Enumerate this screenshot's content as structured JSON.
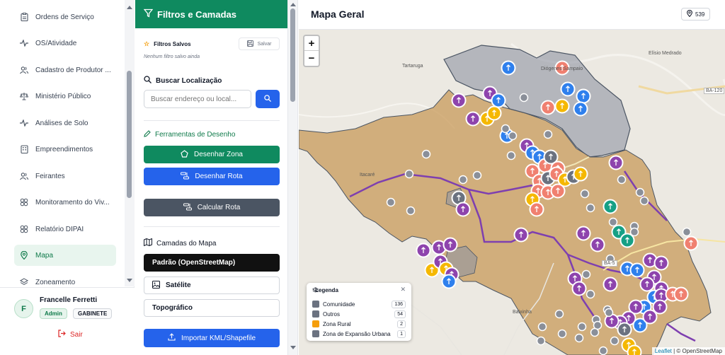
{
  "sidebar": {
    "items": [
      {
        "label": "Ordens de Serviço",
        "icon": "clipboard-icon"
      },
      {
        "label": "OS/Atividade",
        "icon": "activity-icon"
      },
      {
        "label": "Cadastro de Produtor ...",
        "icon": "users-icon"
      },
      {
        "label": "Ministério Público",
        "icon": "scale-icon"
      },
      {
        "label": "Análises de Solo",
        "icon": "activity-icon"
      },
      {
        "label": "Empreendimentos",
        "icon": "building-icon"
      },
      {
        "label": "Feirantes",
        "icon": "users-icon"
      },
      {
        "label": "Monitoramento do Viv...",
        "icon": "grid-icon"
      },
      {
        "label": "Relatório DIPAI",
        "icon": "grid-icon"
      },
      {
        "label": "Mapa",
        "icon": "map-pin-icon",
        "active": true
      },
      {
        "label": "Zoneamento",
        "icon": "layers-icon"
      }
    ],
    "user": {
      "initial": "F",
      "name": "Francelle Ferretti",
      "role": "Admin",
      "department": "GABINETE",
      "logout": "Sair"
    }
  },
  "panel": {
    "title": "Filtros e Camadas",
    "saved_filters": {
      "label": "Filtros Salvos",
      "save": "Salvar",
      "empty": "Nenhum filtro salvo ainda"
    },
    "search": {
      "title": "Buscar Localização",
      "placeholder": "Buscar endereço ou local..."
    },
    "drawing": {
      "title": "Ferramentas de Desenho",
      "zone": "Desenhar Zona",
      "route": "Desenhar Rota",
      "calc": "Calcular Rota"
    },
    "layers": {
      "title": "Camadas do Mapa",
      "items": [
        "Padrão (OpenStreetMap)",
        "Satélite",
        "Topográfico"
      ],
      "selected": "Padrão (OpenStreetMap)"
    },
    "import": "Importar KML/Shapefile"
  },
  "map": {
    "title": "Mapa Geral",
    "count": "539",
    "zoom_in": "+",
    "zoom_out": "−",
    "places": [
      "Tartaruga",
      "Diógenes Sampaio",
      "Elísio Medrado",
      "BA-120",
      "Itacaré",
      "Baixinha",
      "BA-5"
    ],
    "legend": {
      "title": "Legenda",
      "items": [
        {
          "label": "Comunidade",
          "count": "136",
          "color": "#6b7280"
        },
        {
          "label": "Outros",
          "count": "54",
          "color": "#6b7280"
        },
        {
          "label": "Zona Rural",
          "count": "2",
          "color": "#f59e0b"
        },
        {
          "label": "Zona de Expansão Urbana",
          "count": "1",
          "color": "#6b7280"
        }
      ]
    },
    "attribution": {
      "leaflet": "Leaflet",
      "sep": " | © ",
      "osm": "OpenStreetMap"
    },
    "colors": {
      "purple": "#8e44ad",
      "blue": "#2f80ed",
      "salmon": "#f08070",
      "yellow": "#f5b800",
      "teal": "#16a085",
      "gray": "#6b7280",
      "zone_rural": "#d9a564"
    }
  }
}
